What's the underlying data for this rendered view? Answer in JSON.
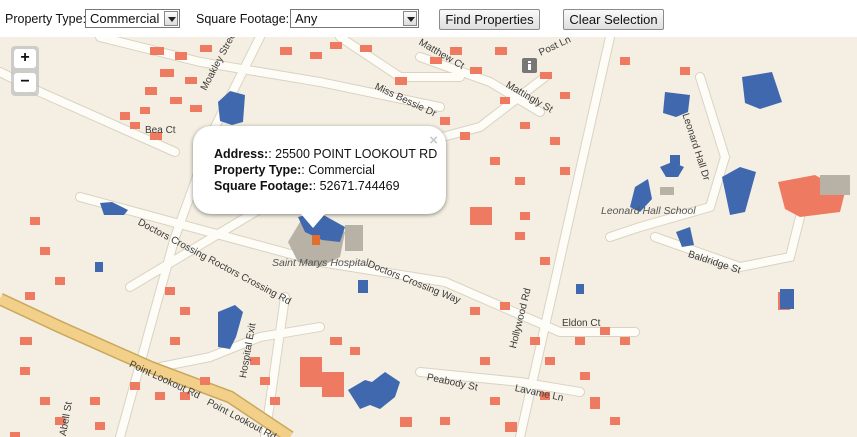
{
  "filters": {
    "property_type_label": "Property Type:",
    "property_type_value": "Commercial",
    "square_footage_label": "Square Footage:",
    "square_footage_value": "Any",
    "find_button": "Find Properties",
    "clear_button": "Clear Selection"
  },
  "map": {
    "zoom_in": "+",
    "zoom_out": "−",
    "colors": {
      "background": "#f4efe2",
      "road": "#fdfcf6",
      "road_casing": "#d9d3c3",
      "major_road": "#f3d089",
      "residential": "#ee7b61",
      "commercial_selected": "#3f68ae",
      "building_gray": "#b7b1a6"
    },
    "labels": {
      "matthew_ct": "Matthew Ct",
      "post_ln": "Post Ln",
      "mattingly_st": "Mattingly St",
      "miss_bessie_dr": "Miss Bessie Dr",
      "moakley_street": "Moakley Street",
      "bea_ct": "Bea Ct",
      "doctors_crossing_roctors": "Doctors Crossing Roctors Crossing Rd",
      "doctors_crossing_way": "Doctors Crossing Way",
      "leonard_hall_dr": "Leonard Hall Dr",
      "baldridge_st": "Baldridge St",
      "hollywood_rd": "Hollywood Rd",
      "eldon_ct": "Eldon Ct",
      "hospital_exit": "Hospital Exit",
      "point_lookout_rd_1": "Point Lookout Rd",
      "point_lookout_rd_2": "Point Lookout Rd",
      "peabody_st": "Peabody St",
      "lavame_ln": "Lavame Ln",
      "abell_st": "Abell St"
    },
    "places": {
      "hospital": "Saint Marys Hospital",
      "school": "Leonard Hall School"
    }
  },
  "popup": {
    "address_label": "Address:",
    "address_value": ": 25500 POINT LOOKOUT RD",
    "type_label": "Property Type:",
    "type_value": ": Commercial",
    "sqft_label": "Square Footage:",
    "sqft_value": ": 52671.744469",
    "close": "×"
  }
}
